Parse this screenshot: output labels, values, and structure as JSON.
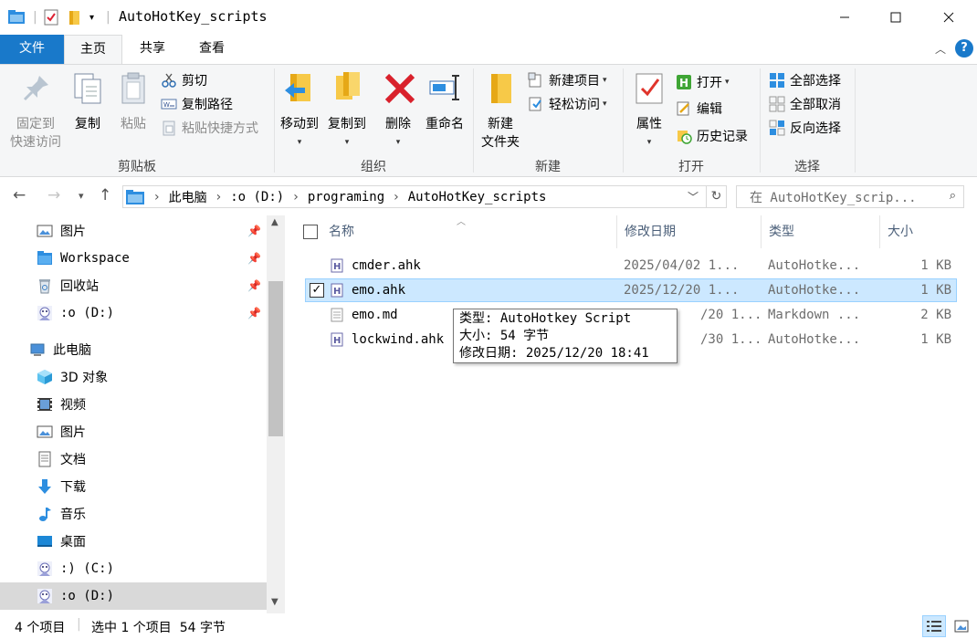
{
  "titlebar": {
    "title": "AutoHotKey_scripts",
    "minimize_icon": "minimize-icon",
    "maximize_icon": "maximize-icon",
    "close_icon": "close-icon"
  },
  "ribbon_tabs": {
    "file": "文件",
    "home": "主页",
    "share": "共享",
    "view": "查看"
  },
  "ribbon": {
    "clipboard": {
      "label": "剪贴板",
      "pin_line1": "固定到",
      "pin_line2": "快速访问",
      "copy": "复制",
      "paste": "粘贴",
      "cut": "剪切",
      "copy_path": "复制路径",
      "paste_shortcut": "粘贴快捷方式"
    },
    "organize": {
      "label": "组织",
      "move_to": "移动到",
      "copy_to": "复制到",
      "delete": "删除",
      "rename": "重命名"
    },
    "new": {
      "label": "新建",
      "new_folder_line1": "新建",
      "new_folder_line2": "文件夹",
      "new_item": "新建项目",
      "easy_access": "轻松访问"
    },
    "open": {
      "label": "打开",
      "properties": "属性",
      "open": "打开",
      "edit": "编辑",
      "history": "历史记录"
    },
    "select": {
      "label": "选择",
      "select_all": "全部选择",
      "select_none": "全部取消",
      "invert": "反向选择"
    }
  },
  "address": {
    "crumbs": [
      "此电脑",
      ":o (D:)",
      "programing",
      "AutoHotKey_scripts"
    ],
    "search_placeholder": "在 AutoHotKey_scrip..."
  },
  "navpane": {
    "items": [
      {
        "label": "图片",
        "icon": "pictures-icon",
        "pinned": true
      },
      {
        "label": "Workspace",
        "icon": "folder-icon",
        "pinned": true
      },
      {
        "label": "回收站",
        "icon": "recycle-bin-icon",
        "pinned": true
      },
      {
        "label": ":o (D:)",
        "icon": "drive-icon",
        "pinned": true
      },
      {
        "label": "此电脑",
        "icon": "computer-icon"
      },
      {
        "label": "3D 对象",
        "icon": "3d-objects-icon"
      },
      {
        "label": "视频",
        "icon": "videos-icon"
      },
      {
        "label": "图片",
        "icon": "pictures-icon"
      },
      {
        "label": "文档",
        "icon": "documents-icon"
      },
      {
        "label": "下载",
        "icon": "downloads-icon"
      },
      {
        "label": "音乐",
        "icon": "music-icon"
      },
      {
        "label": "桌面",
        "icon": "desktop-icon"
      },
      {
        "label": ":) (C:)",
        "icon": "drive-icon"
      },
      {
        "label": ":o (D:)",
        "icon": "drive-icon",
        "selected": true
      }
    ]
  },
  "filelist": {
    "columns": {
      "name": "名称",
      "date": "修改日期",
      "type": "类型",
      "size": "大小"
    },
    "rows": [
      {
        "name": "cmder.ahk",
        "date": "2025/04/02 1...",
        "type": "AutoHotke...",
        "size": "1 KB",
        "icon": "ahk-file-icon"
      },
      {
        "name": "emo.ahk",
        "date": "2025/12/20 1...",
        "type": "AutoHotke...",
        "size": "1 KB",
        "icon": "ahk-file-icon",
        "selected": true
      },
      {
        "name": "emo.md",
        "date": "/20 1...",
        "type": "Markdown ...",
        "size": "2 KB",
        "icon": "md-file-icon"
      },
      {
        "name": "lockwind.ahk",
        "date": "/30 1...",
        "type": "AutoHotke...",
        "size": "1 KB",
        "icon": "ahk-file-icon"
      }
    ]
  },
  "tooltip": {
    "line1": "类型: AutoHotkey Script",
    "line2": "大小: 54 字节",
    "line3": "修改日期: 2025/12/20 18:41"
  },
  "statusbar": {
    "count": "4 个项目",
    "selection": "选中 1 个项目  54 字节"
  },
  "colors": {
    "accent": "#1979ca",
    "selection": "#cce8ff"
  }
}
